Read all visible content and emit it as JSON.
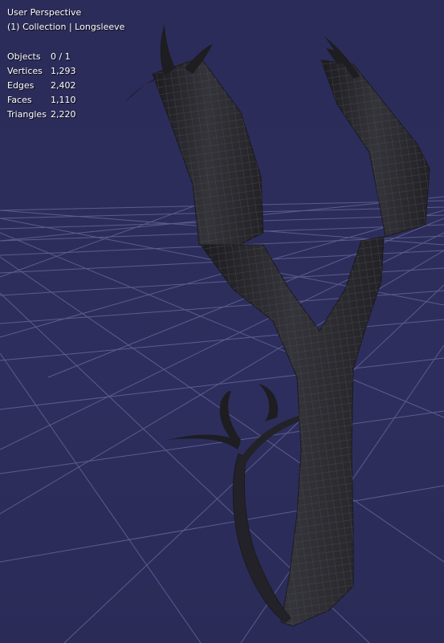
{
  "viewport": {
    "perspective_label": "User Perspective",
    "collection_label": "(1) Collection | Longsleeve",
    "background_color": "#2c2c5a",
    "grid_color": "#7f84b4",
    "mesh_color": "#2a2a2e",
    "wire_color": "#44444c"
  },
  "stats": [
    {
      "label": "Objects",
      "value": "0 / 1"
    },
    {
      "label": "Vertices",
      "value": "1,293"
    },
    {
      "label": "Edges",
      "value": "2,402"
    },
    {
      "label": "Faces",
      "value": "1,110"
    },
    {
      "label": "Triangles",
      "value": "2,220"
    }
  ]
}
